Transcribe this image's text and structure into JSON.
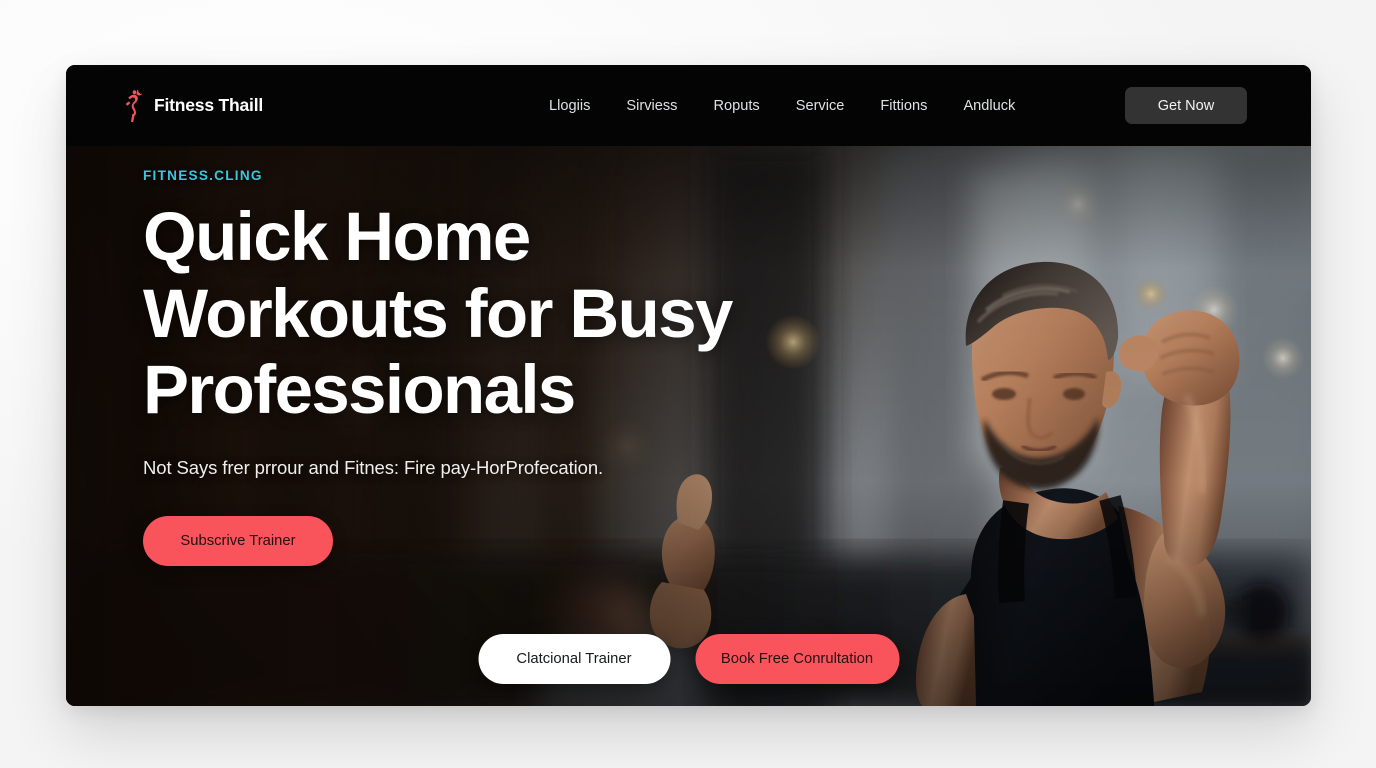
{
  "brand": {
    "name": "Fitness Thaill",
    "icon": "running-figure-icon",
    "icon_color": "#f0545c"
  },
  "nav": {
    "items": [
      {
        "label": "Llogiis"
      },
      {
        "label": "Sirviess"
      },
      {
        "label": "Roputs"
      },
      {
        "label": "Service"
      },
      {
        "label": "Fittions"
      },
      {
        "label": "Andluck"
      }
    ],
    "cta_label": "Get Now"
  },
  "hero": {
    "eyebrow": "FITNESS.CLING",
    "eyebrow_color": "#38c7dd",
    "headline": "Quick Home Workouts for Busy Professionals",
    "subhead": "Not Says frer prrour and Fitnes: Fire pay-HorProfecation.",
    "primary_cta": "Subscrive Trainer",
    "primary_cta_color": "#f9545c",
    "image_alt": "bearded man in black tank top flexing bicep in a gym"
  },
  "bottom_ctas": {
    "secondary_label": "Clatcional Trainer",
    "primary_label": "Book Free Conrultation"
  }
}
